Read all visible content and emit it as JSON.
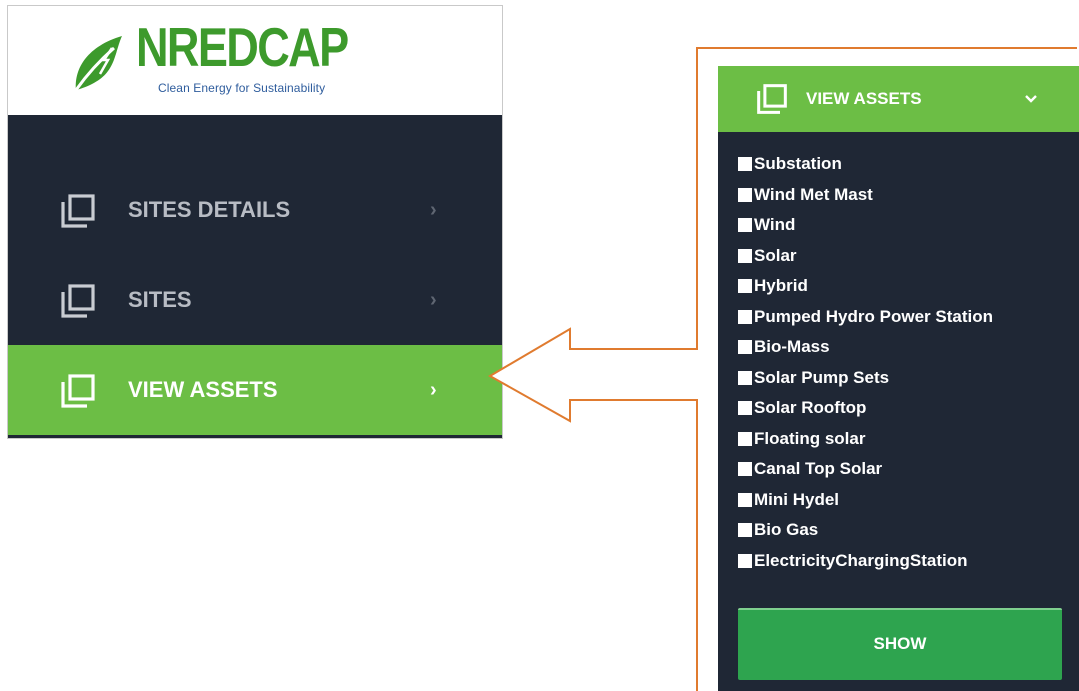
{
  "logo": {
    "title": "NREDCAP",
    "tagline": "Clean Energy for Sustainability"
  },
  "sidebar": {
    "items": [
      {
        "label": "SITES DETAILS",
        "icon": "copy-icon",
        "chevron": "›",
        "active": false
      },
      {
        "label": "SITES",
        "icon": "copy-icon",
        "chevron": "›",
        "active": false
      },
      {
        "label": "VIEW ASSETS",
        "icon": "copy-icon",
        "chevron": "›",
        "active": true
      }
    ]
  },
  "panel": {
    "header_label": "VIEW ASSETS",
    "header_icon": "copy-icon",
    "header_chevron": "chevron-down-icon",
    "assets": [
      "Substation",
      "Wind Met Mast",
      "Wind",
      "Solar",
      "Hybrid",
      "Pumped Hydro Power Station",
      "Bio-Mass",
      "Solar Pump Sets",
      "Solar Rooftop",
      "Floating solar",
      "Canal Top Solar",
      "Mini Hydel",
      "Bio Gas",
      "ElectricityChargingStation"
    ],
    "show_label": "SHOW"
  },
  "colors": {
    "sidebar_bg": "#1f2735",
    "accent_green": "#6cbe45",
    "button_green": "#2ea44f",
    "callout_orange": "#e07b2f",
    "logo_green": "#3d9a2c",
    "logo_blue": "#2f5d9d"
  }
}
